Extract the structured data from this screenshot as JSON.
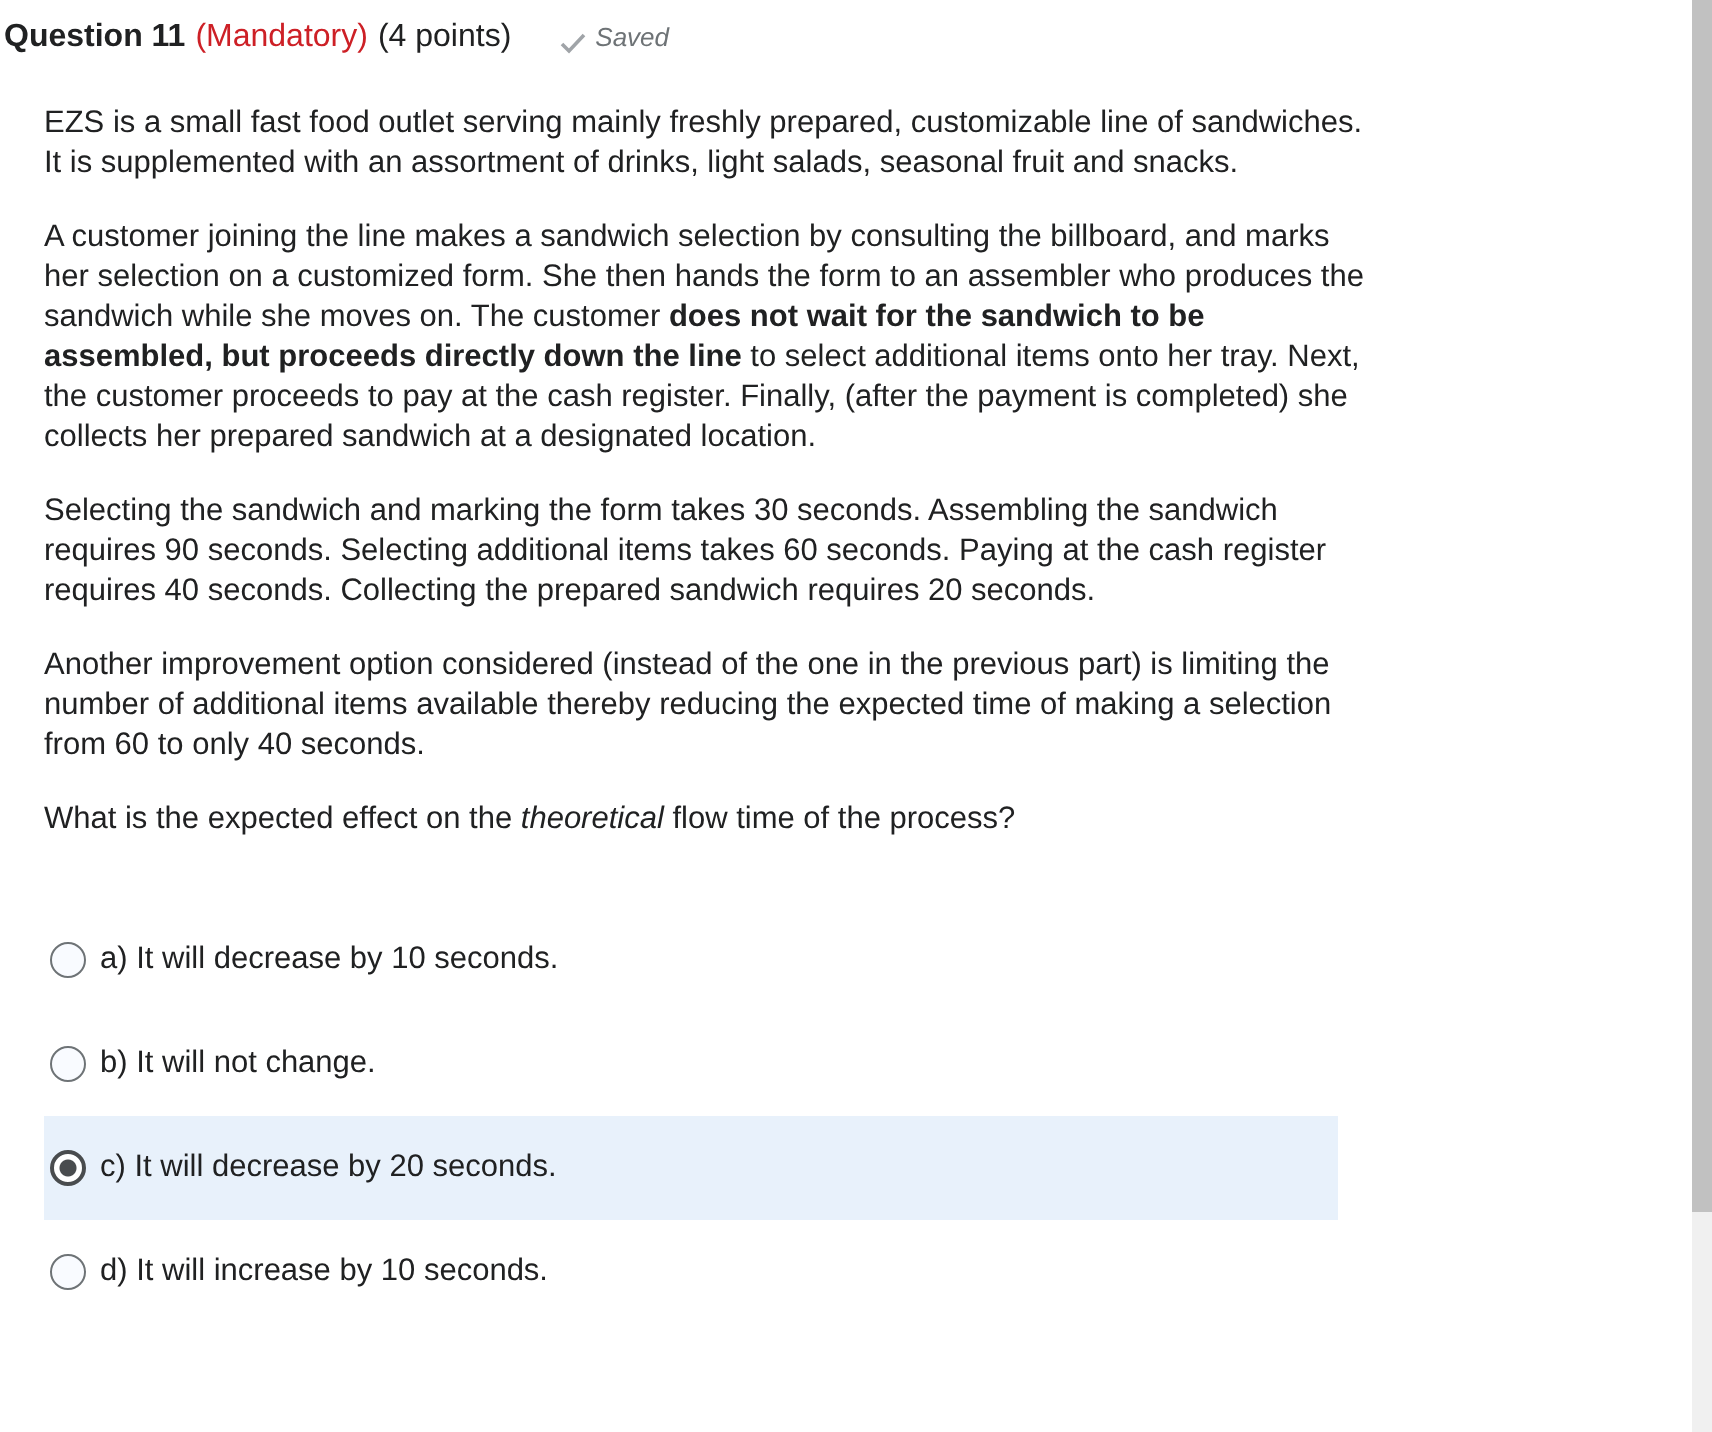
{
  "question": {
    "number": "Question 11",
    "mandatory": "(Mandatory)",
    "points": "(4 points)",
    "saved": "Saved"
  },
  "paragraphs": [
    "EZS is a small fast food outlet serving mainly freshly prepared, customizable line of sandwiches. It is supplemented with an assortment of drinks, light salads, seasonal fruit and snacks.",
    "A customer joining the line makes a sandwich selection by consulting the billboard, and marks her selection on a customized form. She then hands the form to an assembler who produces the sandwich while she moves on. The customer **does not wait for the sandwich to be assembled, but proceeds directly down the line** to select additional items onto her tray. Next, the customer proceeds to pay at the cash register. Finally, (after the payment is completed) she collects her prepared sandwich at a designated location.",
    "Selecting the sandwich and marking the form takes 30 seconds. Assembling the sandwich requires 90 seconds. Selecting additional items takes 60 seconds. Paying at the cash register requires 40 seconds. Collecting the prepared sandwich requires 20 seconds.",
    "Another improvement option considered (instead of the one in the previous part) is limiting the number of additional items available thereby reducing the expected time of making a selection from 60 to only 40 seconds.",
    "What is the expected effect on the *theoretical* flow time of the process?"
  ],
  "options": [
    {
      "label": "a) It will decrease by 10 seconds.",
      "selected": false
    },
    {
      "label": "b) It will not change.",
      "selected": false
    },
    {
      "label": "c) It will decrease by 20 seconds.",
      "selected": true
    },
    {
      "label": "d) It will increase by 10 seconds.",
      "selected": false
    }
  ]
}
